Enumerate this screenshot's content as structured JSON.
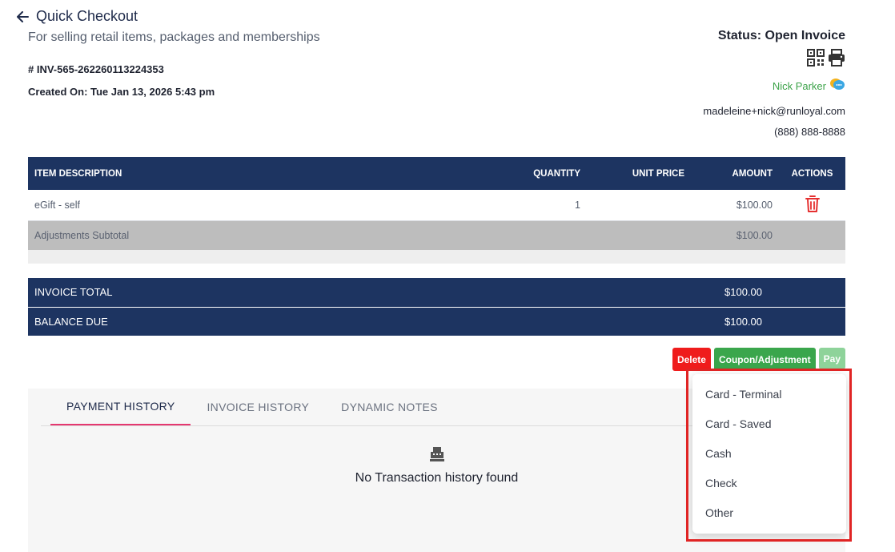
{
  "header": {
    "title": "Quick Checkout",
    "subtitle": "For selling retail items, packages and memberships",
    "invoice_number": "# INV-565-262260113224353",
    "created_on": "Created On: Tue Jan 13, 2026 5:43 pm"
  },
  "customer": {
    "status": "Status: Open Invoice",
    "name": "Nick Parker",
    "email": "madeleine+nick@runloyal.com",
    "phone": "(888) 888-8888"
  },
  "items_table": {
    "columns": [
      "ITEM DESCRIPTION",
      "QUANTITY",
      "UNIT PRICE",
      "AMOUNT",
      "ACTIONS"
    ],
    "rows": [
      {
        "description": "eGift - self",
        "quantity": "1",
        "unit_price": "",
        "amount": "$100.00"
      }
    ],
    "adjustments": {
      "label": "Adjustments Subtotal",
      "amount": "$100.00"
    }
  },
  "totals": {
    "invoice_total_label": "INVOICE TOTAL",
    "invoice_total": "$100.00",
    "balance_due_label": "BALANCE DUE",
    "balance_due": "$100.00"
  },
  "actions": {
    "delete": "Delete",
    "coupon": "Coupon/Adjustment",
    "pay": "Pay"
  },
  "history": {
    "tabs": [
      "PAYMENT HISTORY",
      "INVOICE HISTORY",
      "DYNAMIC NOTES"
    ],
    "active_tab": "PAYMENT HISTORY",
    "empty_message": "No Transaction history found"
  },
  "pay_menu": {
    "options": [
      "Card - Terminal",
      "Card - Saved",
      "Cash",
      "Check",
      "Other"
    ]
  },
  "icons": {
    "back": "arrow-left-icon",
    "qr": "qr-code-icon",
    "print": "printer-icon",
    "chat": "chat-icon",
    "delete_row": "trash-icon",
    "register": "cash-register-icon"
  },
  "colors": {
    "navy": "#1d3461",
    "delete": "#ef1c1c",
    "coupon": "#3aa64c",
    "pay": "#8ed39a",
    "tab_accent": "#e53870",
    "highlight": "#e02424"
  }
}
